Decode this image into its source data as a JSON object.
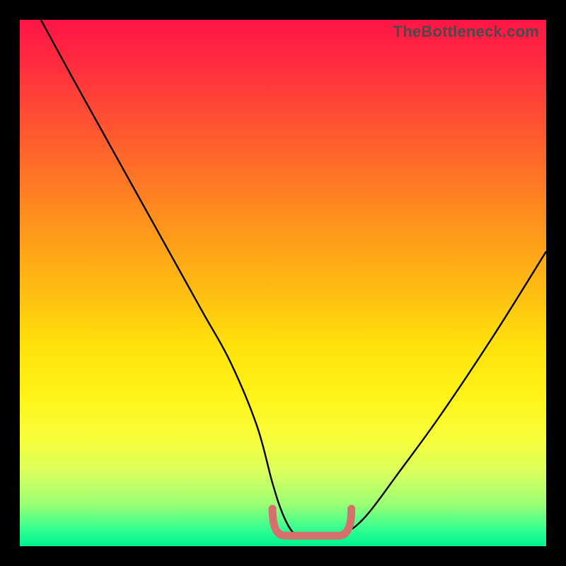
{
  "watermark_text": "TheBottleneck.com",
  "colors": {
    "frame": "#000000",
    "curve": "#000000",
    "bottom_marker": "#d5706c"
  },
  "chart_data": {
    "type": "line",
    "title": "",
    "xlabel": "",
    "ylabel": "",
    "xlim": [
      0,
      100
    ],
    "ylim": [
      0,
      100
    ],
    "series": [
      {
        "name": "bottleneck-curve",
        "x": [
          4,
          10,
          15,
          20,
          25,
          30,
          35,
          40,
          45,
          48,
          50,
          52,
          54,
          56,
          58,
          60,
          62,
          66,
          72,
          80,
          90,
          100
        ],
        "values": [
          100,
          89,
          80,
          71,
          62,
          53,
          44,
          35,
          23,
          12,
          6,
          2.5,
          2,
          2,
          2,
          2,
          2.5,
          6,
          14,
          25,
          40,
          56
        ]
      }
    ],
    "annotations": [
      {
        "name": "optimal-flat-region",
        "x_start": 48,
        "x_end": 63,
        "y": 2
      }
    ]
  }
}
